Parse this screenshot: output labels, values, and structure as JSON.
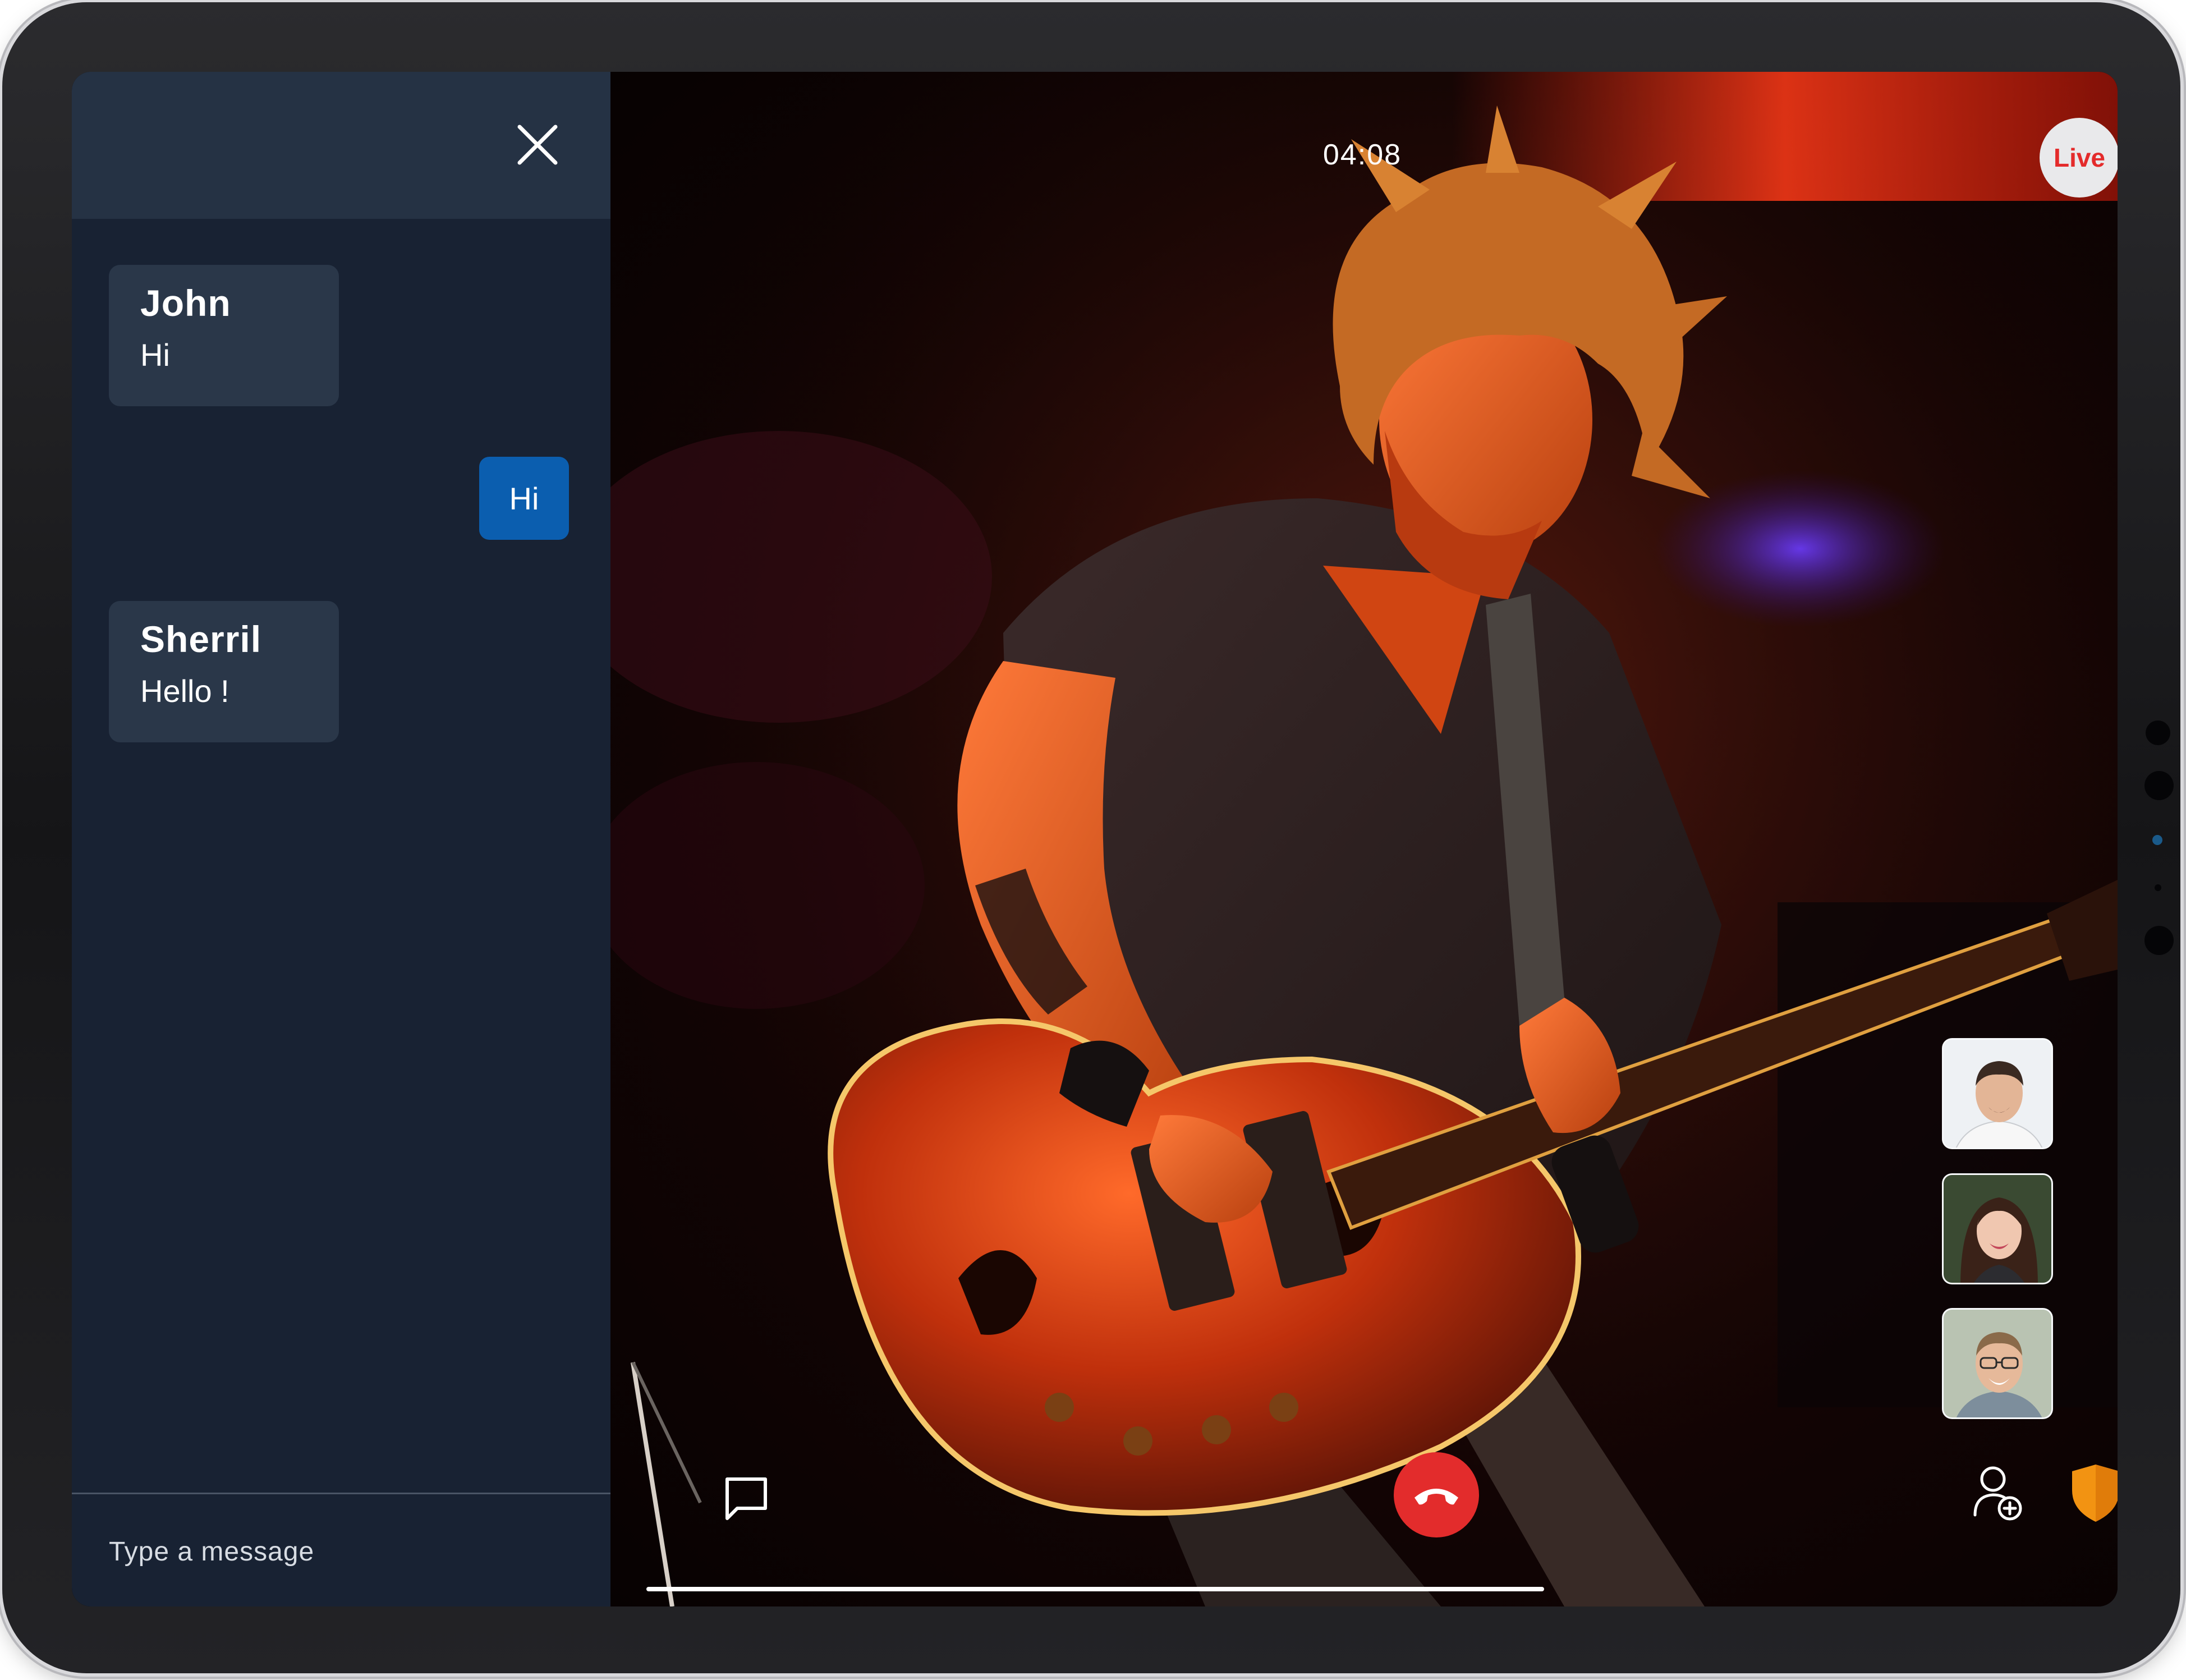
{
  "chat": {
    "messages": [
      {
        "sender": "John",
        "text": "Hi"
      },
      {
        "own": true,
        "text": "Hi"
      },
      {
        "sender": "Sherril",
        "text": "Hello !"
      }
    ],
    "composer_placeholder": "Type a message"
  },
  "call": {
    "timer": "04:08",
    "live_badge": "Live"
  },
  "participants": [
    {
      "icon": "participant-man-avatar"
    },
    {
      "icon": "participant-woman-avatar"
    },
    {
      "icon": "participant-man-glasses-avatar"
    }
  ],
  "icons": {
    "close": "close-icon",
    "chat": "chat-bubble-icon",
    "end_call": "phone-hangup-icon",
    "add_participant": "add-person-icon",
    "security": "shield-icon"
  },
  "colors": {
    "chat_panel_bg": "#182233",
    "chat_header_bg": "#253244",
    "bubble_bg": "#2a3749",
    "own_bubble_bg": "#0b5eaf",
    "end_call_red": "#e32c2c",
    "live_text_red": "#e42b2b",
    "shield_orange": "#f29312"
  }
}
